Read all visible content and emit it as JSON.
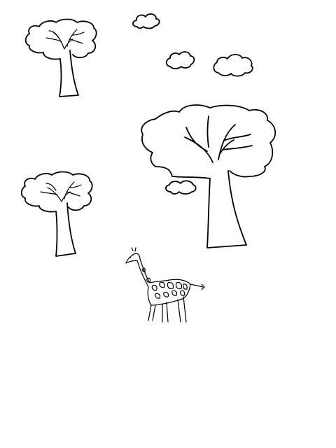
{
  "colors": {
    "background": "#ffffff",
    "ink": "#000000"
  },
  "scene": {
    "clouds": [
      {
        "name": "cloud-small-top"
      },
      {
        "name": "cloud-middle"
      },
      {
        "name": "cloud-right"
      }
    ],
    "trees": [
      {
        "name": "tree-top-left"
      },
      {
        "name": "tree-large-center"
      },
      {
        "name": "tree-mid-left"
      }
    ],
    "animals": [
      {
        "name": "giraffe"
      }
    ]
  }
}
